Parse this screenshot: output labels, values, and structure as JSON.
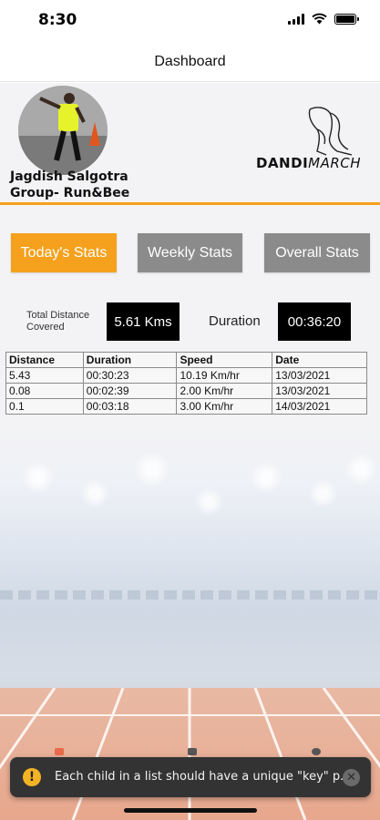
{
  "status_bar": {
    "time": "8:30",
    "icons": [
      "signal-icon",
      "wifi-icon",
      "battery-icon"
    ]
  },
  "header": {
    "title": "Dashboard"
  },
  "profile": {
    "name": "Jagdish Salgotra",
    "group": "Group- Run&Bee",
    "avatar": "avatar-photo"
  },
  "logo": {
    "text_bold": "DANDI",
    "text_light": "MARCH"
  },
  "tabs": [
    {
      "label": "Today's Stats",
      "active": true
    },
    {
      "label": "Weekly Stats",
      "active": false
    },
    {
      "label": "Overall Stats",
      "active": false
    }
  ],
  "summary": {
    "distance_label_line1": "Total Distance",
    "distance_label_line2": "Covered",
    "distance_value": "5.61 Kms",
    "duration_label": "Duration",
    "duration_value": "00:36:20"
  },
  "table": {
    "headers": [
      "Distance",
      "Duration",
      "Speed",
      "Date"
    ],
    "rows": [
      [
        "5.43",
        "00:30:23",
        "10.19 Km/hr",
        "13/03/2021"
      ],
      [
        "0.08",
        "00:02:39",
        "2.00 Km/hr",
        "13/03/2021"
      ],
      [
        "0.1",
        "00:03:18",
        "3.00 Km/hr",
        "14/03/2021"
      ]
    ]
  },
  "toast": {
    "icon_text": "!",
    "message": "Each child in a list should have a unique \"key\" p...",
    "dismiss_icon_text": "✕"
  },
  "colors": {
    "accent": "#f5a11d",
    "inactive_tab": "#8b8b8b",
    "value_box": "#000000",
    "toast_bg": "#333333",
    "warning": "#f3b325"
  }
}
